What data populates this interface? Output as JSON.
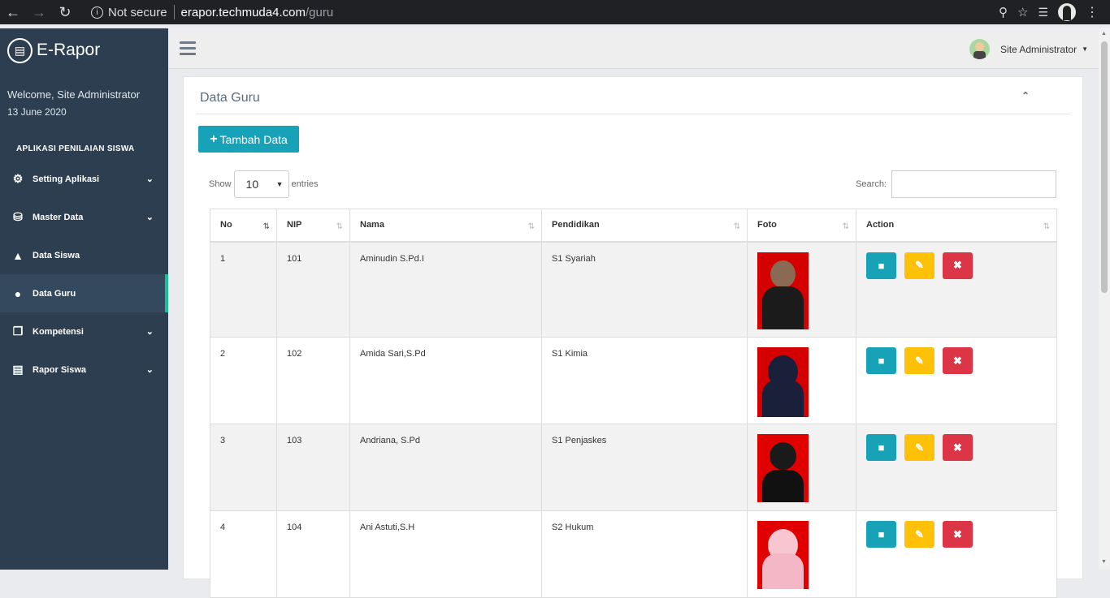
{
  "browser": {
    "security": "Not secure",
    "url_host": "erapor.techmuda4.com",
    "url_path": "/guru"
  },
  "sidebar": {
    "brand": "E-Rapor",
    "welcome": "Welcome, Site Administrator",
    "date": "13 June 2020",
    "section": "APLIKASI PENILAIAN SISWA",
    "items": [
      {
        "label": "Setting Aplikasi",
        "icon": "gear-icon",
        "has_chevron": true
      },
      {
        "label": "Master Data",
        "icon": "database-icon",
        "has_chevron": true
      },
      {
        "label": "Data Siswa",
        "icon": "graduation-cap-icon",
        "has_chevron": false
      },
      {
        "label": "Data Guru",
        "icon": "user-icon",
        "has_chevron": false,
        "active": true
      },
      {
        "label": "Kompetensi",
        "icon": "copy-icon",
        "has_chevron": true
      },
      {
        "label": "Rapor Siswa",
        "icon": "book-icon",
        "has_chevron": true
      }
    ]
  },
  "header": {
    "user": "Site Administrator"
  },
  "card": {
    "title": "Data Guru",
    "add_button": "Tambah Data",
    "show_label": "Show",
    "entries_value": "10",
    "entries_label": "entries",
    "search_label": "Search:"
  },
  "table": {
    "columns": [
      "No",
      "NIP",
      "Nama",
      "Pendidikan",
      "Foto",
      "Action"
    ],
    "rows": [
      {
        "no": "1",
        "nip": "101",
        "nama": "Aminudin S.Pd.I",
        "pendidikan": "S1 Syariah"
      },
      {
        "no": "2",
        "nip": "102",
        "nama": "Amida Sari,S.Pd",
        "pendidikan": "S1 Kimia"
      },
      {
        "no": "3",
        "nip": "103",
        "nama": "Andriana, S.Pd",
        "pendidikan": "S1 Penjaskes"
      },
      {
        "no": "4",
        "nip": "104",
        "nama": "Ani Astuti,S.H",
        "pendidikan": "S2 Hukum"
      }
    ]
  },
  "colors": {
    "sidebar_bg": "#2c3e50",
    "accent": "#1abc9c",
    "primary": "#17a2b8",
    "warning": "#ffc107",
    "danger": "#dc3545",
    "photo_bg": "#e00000"
  }
}
